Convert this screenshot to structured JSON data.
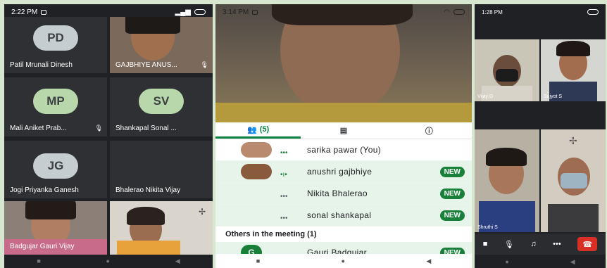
{
  "phone1": {
    "status_time": "2:22 PM",
    "tiles": [
      {
        "initials": "PD",
        "name": "Patil  Mrunali Dinesh"
      },
      {
        "name": "GAJBHIYE ANUS..."
      },
      {
        "initials": "MP",
        "name": "Mali Aniket Prab..."
      },
      {
        "initials": "SV",
        "name": "Shankapal Sonal ..."
      },
      {
        "initials": "JG",
        "name": "Jogi Priyanka Ganesh"
      },
      {
        "name": "Bhalerao Nikita Vijay"
      },
      {
        "name": "Badgujar Gauri Vijay"
      },
      {
        "name": ""
      }
    ]
  },
  "phone2": {
    "status_time": "3:14 PM",
    "tabs": {
      "people_count": "(5)"
    },
    "participants": [
      {
        "name": "sarika pawar (You)",
        "badge": ""
      },
      {
        "name": "anushri gajbhiye",
        "badge": "NEW"
      },
      {
        "name": "Nikita Bhalerao",
        "badge": "NEW"
      },
      {
        "name": "sonal shankapal",
        "badge": "NEW"
      }
    ],
    "others_header": "Others in the meeting (1)",
    "others": [
      {
        "initial": "G",
        "name": "Gauri Badgujar",
        "badge": "NEW"
      }
    ]
  },
  "phone3": {
    "status_time": "1:28 PM",
    "tiles": [
      {
        "name": "Vijay D"
      },
      {
        "name": "Sujyot S"
      },
      {
        "name": "Shruthi S"
      },
      {
        "name": ""
      }
    ]
  }
}
